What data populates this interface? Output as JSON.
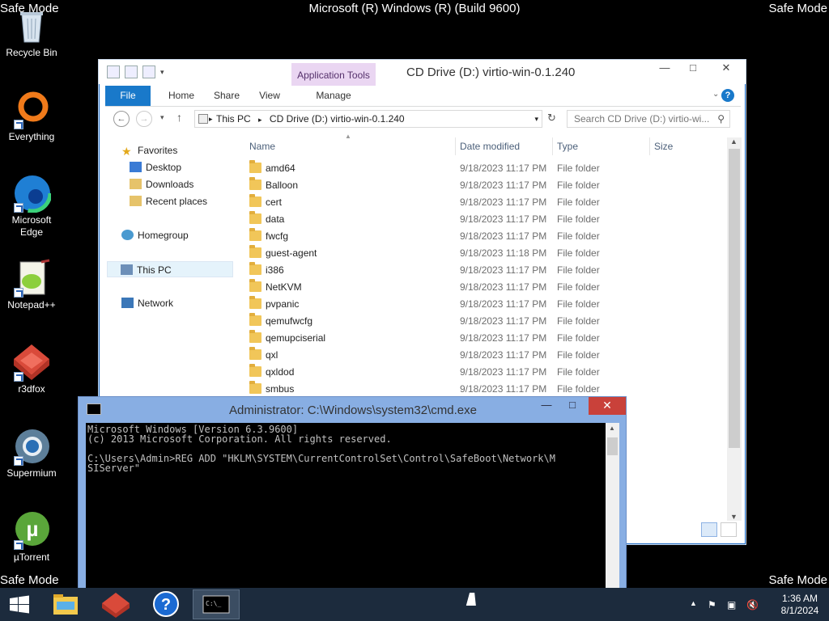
{
  "screen": {
    "safe_mode_label": "Safe Mode",
    "build_label": "Microsoft (R) Windows (R) (Build 9600)"
  },
  "desktop_icons": [
    {
      "label": "Recycle Bin",
      "icon": "recycle-bin-icon"
    },
    {
      "label": "Everything",
      "icon": "everything-icon"
    },
    {
      "label": "Microsoft Edge",
      "icon": "edge-icon"
    },
    {
      "label": "Notepad++",
      "icon": "notepadpp-icon"
    },
    {
      "label": "r3dfox",
      "icon": "r3dfox-icon"
    },
    {
      "label": "Supermium",
      "icon": "supermium-icon"
    },
    {
      "label": "µTorrent",
      "icon": "utorrent-icon"
    }
  ],
  "explorer": {
    "title": "CD Drive (D:) virtio-win-0.1.240",
    "context_tab": "Application Tools",
    "tabs": [
      "File",
      "Home",
      "Share",
      "View",
      "Manage"
    ],
    "address": {
      "crumbs": [
        "This PC",
        "CD Drive (D:) virtio-win-0.1.240"
      ]
    },
    "search_placeholder": "Search CD Drive (D:) virtio-wi...",
    "nav": {
      "favorites": "Favorites",
      "desktop": "Desktop",
      "downloads": "Downloads",
      "recent": "Recent places",
      "homegroup": "Homegroup",
      "this_pc": "This PC",
      "network": "Network"
    },
    "columns": {
      "name": "Name",
      "date": "Date modified",
      "type": "Type",
      "size": "Size"
    },
    "files": [
      {
        "name": "amd64",
        "date": "9/18/2023 11:17 PM",
        "type": "File folder"
      },
      {
        "name": "Balloon",
        "date": "9/18/2023 11:17 PM",
        "type": "File folder"
      },
      {
        "name": "cert",
        "date": "9/18/2023 11:17 PM",
        "type": "File folder"
      },
      {
        "name": "data",
        "date": "9/18/2023 11:17 PM",
        "type": "File folder"
      },
      {
        "name": "fwcfg",
        "date": "9/18/2023 11:17 PM",
        "type": "File folder"
      },
      {
        "name": "guest-agent",
        "date": "9/18/2023 11:18 PM",
        "type": "File folder"
      },
      {
        "name": "i386",
        "date": "9/18/2023 11:17 PM",
        "type": "File folder"
      },
      {
        "name": "NetKVM",
        "date": "9/18/2023 11:17 PM",
        "type": "File folder"
      },
      {
        "name": "pvpanic",
        "date": "9/18/2023 11:17 PM",
        "type": "File folder"
      },
      {
        "name": "qemufwcfg",
        "date": "9/18/2023 11:17 PM",
        "type": "File folder"
      },
      {
        "name": "qemupciserial",
        "date": "9/18/2023 11:17 PM",
        "type": "File folder"
      },
      {
        "name": "qxl",
        "date": "9/18/2023 11:17 PM",
        "type": "File folder"
      },
      {
        "name": "qxldod",
        "date": "9/18/2023 11:17 PM",
        "type": "File folder"
      },
      {
        "name": "smbus",
        "date": "9/18/2023 11:17 PM",
        "type": "File folder"
      }
    ]
  },
  "cmd": {
    "title": "Administrator: C:\\Windows\\system32\\cmd.exe",
    "lines": [
      "Microsoft Windows [Version 6.3.9600]",
      "(c) 2013 Microsoft Corporation. All rights reserved.",
      "",
      "C:\\Users\\Admin>REG ADD \"HKLM\\SYSTEM\\CurrentControlSet\\Control\\SafeBoot\\Network\\M",
      "SIServer\""
    ]
  },
  "taskbar": {
    "time": "1:36 AM",
    "date": "8/1/2024",
    "items": [
      "start-icon",
      "file-explorer-icon",
      "r3dfox-icon",
      "help-icon",
      "cmd-icon"
    ]
  }
}
